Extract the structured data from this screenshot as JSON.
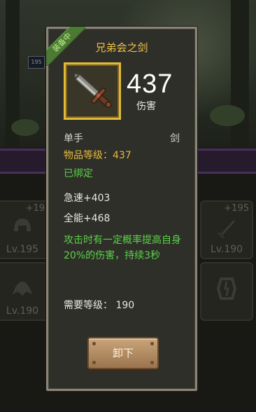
{
  "background": {
    "level_badge": "195",
    "slots": [
      {
        "plus": "+19",
        "level": "Lv.195"
      },
      {
        "plus": "+195",
        "level": "Lv.190"
      },
      {
        "plus": "",
        "level": "Lv.190"
      },
      {
        "plus": "",
        "level": ""
      }
    ]
  },
  "tooltip": {
    "equipped_ribbon": "装备中",
    "item_name": "兄弟会之剑",
    "item_icon": "sword-icon",
    "power_value": "437",
    "power_label": "伤害",
    "hand": "单手",
    "weapon_type": "剑",
    "item_level": "物品等级：437",
    "binding": "已绑定",
    "stat_haste": "急速+403",
    "stat_versatility": "全能+468",
    "effect_text": "攻击时有一定概率提高自身20%的伤害，持续3秒",
    "required_level": "需要等级： 190",
    "unequip_button": "卸下"
  },
  "colors": {
    "title": "#f1c24a",
    "item_level": "#e5b93c",
    "green": "#58d14a",
    "rarity_frame": "#e2b938"
  }
}
